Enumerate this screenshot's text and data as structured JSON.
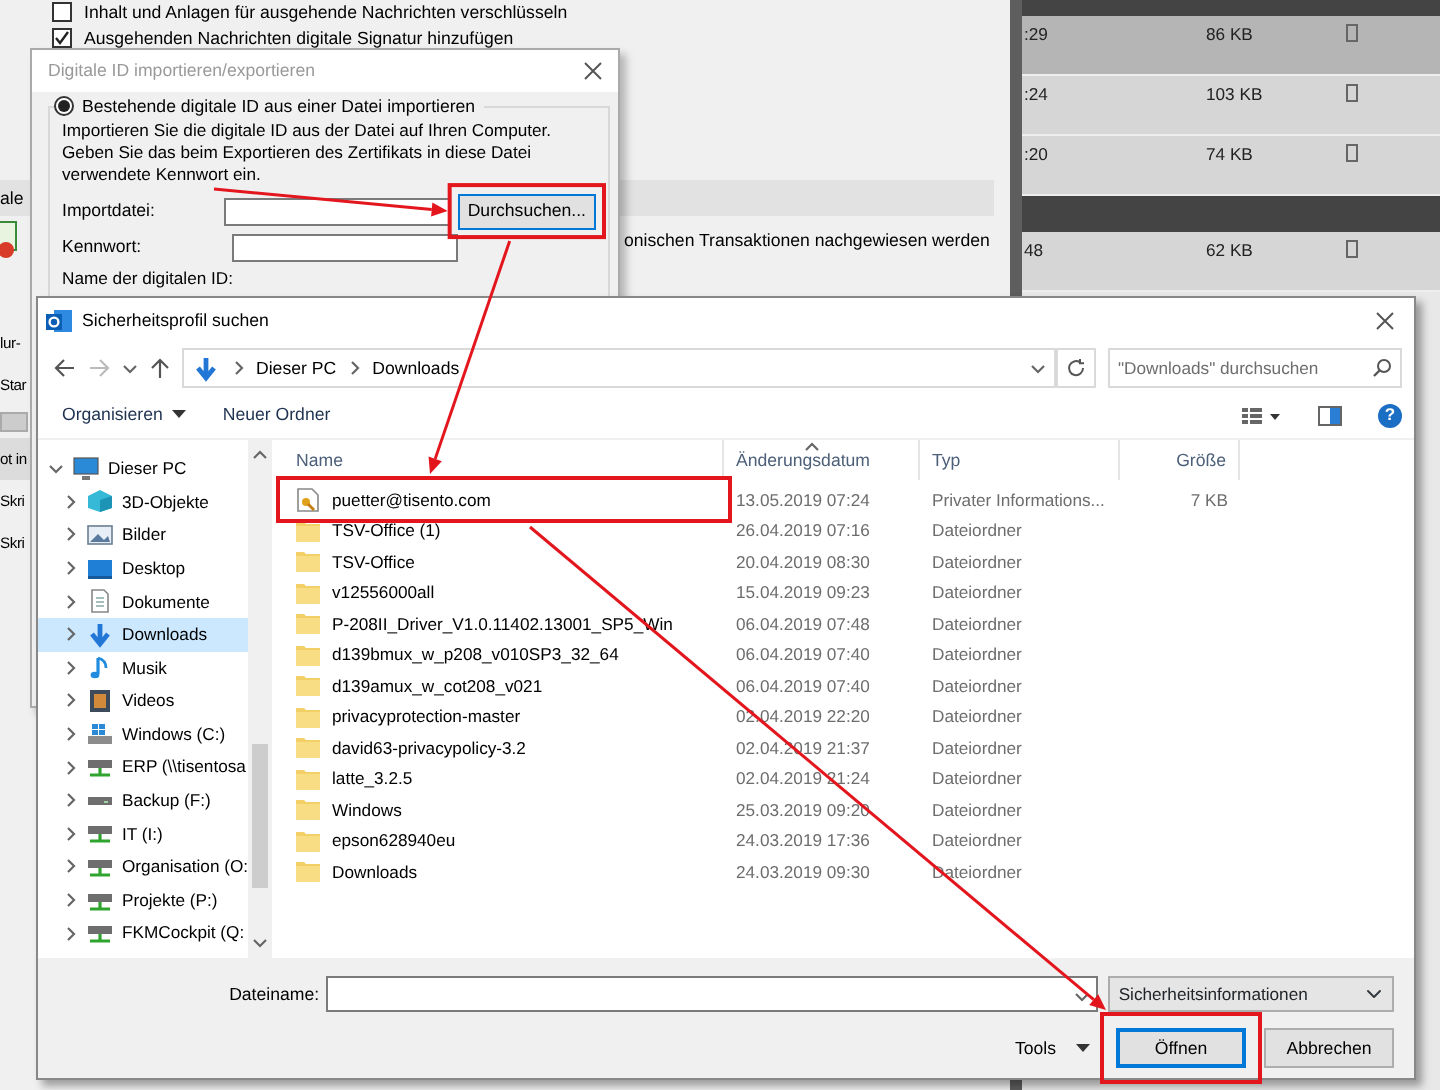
{
  "background_app": {
    "options": [
      {
        "label": "Inhalt und Anlagen für ausgehende Nachrichten verschlüsseln",
        "checked": false
      },
      {
        "label": "Ausgehenden Nachrichten digitale Signatur hinzufügen",
        "checked": true
      }
    ],
    "section_fragment": "ale",
    "description_fragment": "onischen Transaktionen nachgewiesen werden",
    "side_fragments": [
      {
        "kind": "text",
        "text": "lur-"
      },
      {
        "kind": "text",
        "text": "Star"
      },
      {
        "kind": "field"
      },
      {
        "kind": "band",
        "text": "ot in"
      },
      {
        "kind": "text",
        "text": "Skri"
      },
      {
        "kind": "text",
        "text": "Skri"
      }
    ],
    "messages": [
      {
        "kind": "group"
      },
      {
        "kind": "message",
        "time": ":29",
        "size": "86 KB",
        "selected": true
      },
      {
        "kind": "message",
        "time": ":24",
        "size": "103 KB",
        "selected": false
      },
      {
        "kind": "message",
        "time": ":20",
        "size": "74 KB",
        "selected": false
      },
      {
        "kind": "group"
      },
      {
        "kind": "message",
        "time": "48",
        "size": "62 KB",
        "selected": false
      }
    ]
  },
  "import_dialog": {
    "title": "Digitale ID importieren/exportieren",
    "option": {
      "label": "Bestehende digitale ID aus einer Datei importieren",
      "selected": true
    },
    "instructions": "Importieren Sie die digitale ID aus der Datei auf Ihren Computer. Geben Sie das beim Exportieren des Zertifikats in diese Datei verwendete Kennwort ein.",
    "fields": [
      {
        "label": "Importdatei:"
      },
      {
        "label": "Kennwort:"
      }
    ],
    "browse_button": "Durchsuchen...",
    "name_label": "Name der digitalen ID:"
  },
  "file_dialog": {
    "title": "Sicherheitsprofil suchen",
    "breadcrumb": [
      "Dieser PC",
      "Downloads"
    ],
    "search": {
      "placeholder": "\"Downloads\" durchsuchen"
    },
    "toolbar": {
      "organize": "Organisieren",
      "new_folder": "Neuer Ordner",
      "help": "?"
    },
    "tree": [
      {
        "label": "Dieser PC",
        "kind": "pc",
        "expanded": true,
        "selected": false,
        "children": [
          {
            "label": "3D-Objekte",
            "kind": "objects",
            "expanded": false,
            "selected": false
          },
          {
            "label": "Bilder",
            "kind": "pictures",
            "expanded": false,
            "selected": false
          },
          {
            "label": "Desktop",
            "kind": "desktop",
            "expanded": false,
            "selected": false
          },
          {
            "label": "Dokumente",
            "kind": "documents",
            "expanded": false,
            "selected": false
          },
          {
            "label": "Downloads",
            "kind": "downloads",
            "expanded": false,
            "selected": true
          },
          {
            "label": "Musik",
            "kind": "music",
            "expanded": false,
            "selected": false
          },
          {
            "label": "Videos",
            "kind": "videos",
            "expanded": false,
            "selected": false
          },
          {
            "label": "Windows (C:)",
            "kind": "system_drive",
            "expanded": false,
            "selected": false
          },
          {
            "label": "ERP (\\\\tisentosa",
            "kind": "network",
            "expanded": false,
            "selected": false
          },
          {
            "label": "Backup (F:)",
            "kind": "drive",
            "expanded": false,
            "selected": false
          },
          {
            "label": "IT (I:)",
            "kind": "network",
            "expanded": false,
            "selected": false
          },
          {
            "label": "Organisation (O:",
            "kind": "network",
            "expanded": false,
            "selected": false
          },
          {
            "label": "Projekte (P:)",
            "kind": "network",
            "expanded": false,
            "selected": false
          },
          {
            "label": "FKMCockpit (Q:",
            "kind": "network",
            "expanded": false,
            "selected": false
          }
        ]
      }
    ],
    "columns": [
      "Name",
      "Änderungsdatum",
      "Typ",
      "Größe"
    ],
    "files": [
      {
        "kind": "certificate",
        "name": "puetter@tisento.com",
        "date": "13.05.2019 07:24",
        "type": "Privater Informations...",
        "size": "7 KB"
      },
      {
        "kind": "folder",
        "name": "TSV-Office (1)",
        "date": "26.04.2019 07:16",
        "type": "Dateiordner"
      },
      {
        "kind": "folder",
        "name": "TSV-Office",
        "date": "20.04.2019 08:30",
        "type": "Dateiordner"
      },
      {
        "kind": "folder",
        "name": "v12556000all",
        "date": "15.04.2019 09:23",
        "type": "Dateiordner"
      },
      {
        "kind": "folder",
        "name": "P-208II_Driver_V1.0.11402.13001_SP5_Win",
        "date": "06.04.2019 07:48",
        "type": "Dateiordner"
      },
      {
        "kind": "folder",
        "name": "d139bmux_w_p208_v010SP3_32_64",
        "date": "06.04.2019 07:40",
        "type": "Dateiordner"
      },
      {
        "kind": "folder",
        "name": "d139amux_w_cot208_v021",
        "date": "06.04.2019 07:40",
        "type": "Dateiordner"
      },
      {
        "kind": "folder",
        "name": "privacyprotection-master",
        "date": "02.04.2019 22:20",
        "type": "Dateiordner"
      },
      {
        "kind": "folder",
        "name": "david63-privacypolicy-3.2",
        "date": "02.04.2019 21:37",
        "type": "Dateiordner"
      },
      {
        "kind": "folder",
        "name": "latte_3.2.5",
        "date": "02.04.2019 21:24",
        "type": "Dateiordner"
      },
      {
        "kind": "folder",
        "name": "Windows",
        "date": "25.03.2019 09:20",
        "type": "Dateiordner"
      },
      {
        "kind": "folder",
        "name": "epson628940eu",
        "date": "24.03.2019 17:36",
        "type": "Dateiordner"
      },
      {
        "kind": "folder",
        "name": "Downloads",
        "date": "24.03.2019 09:30",
        "type": "Dateiordner"
      }
    ],
    "filename_label": "Dateiname:",
    "file_type": "Sicherheitsinformationen",
    "tools": "Tools",
    "buttons": [
      {
        "label": "Öffnen",
        "default": true
      },
      {
        "label": "Abbrechen",
        "default": false
      }
    ]
  }
}
